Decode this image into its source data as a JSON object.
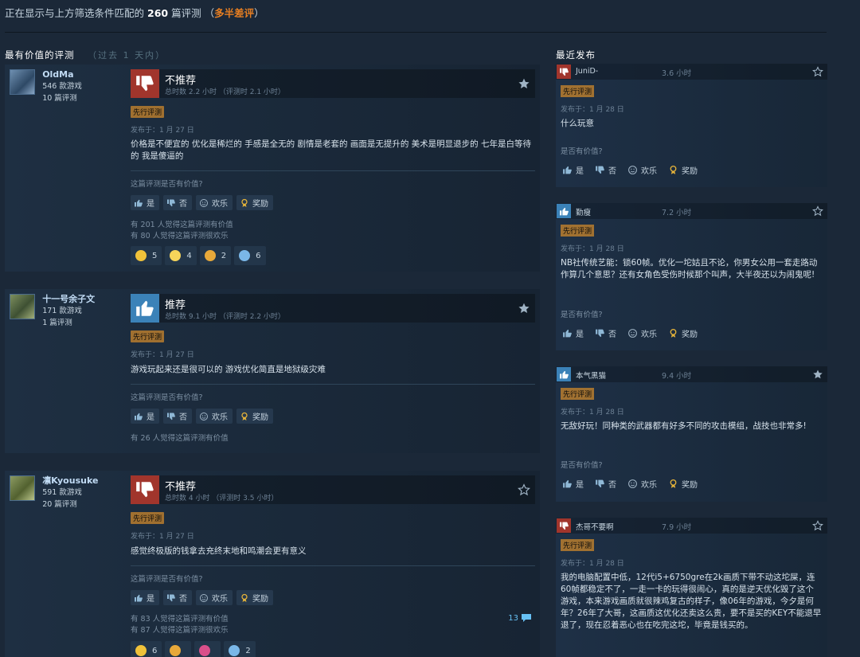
{
  "header": {
    "prefix": "正在显示与上方筛选条件匹配的",
    "count": "260",
    "suffix": "篇评测",
    "paren_open": "（",
    "rating": "多半差评",
    "paren_close": "）"
  },
  "most_helpful": {
    "title": "最有价值的评测",
    "subtitle": "（过去 1 天内）"
  },
  "recent_title": "最近发布",
  "labels": {
    "early_access": "先行评测",
    "helpful_question": "这篇评测是否有价值?",
    "yes": "是",
    "no": "否",
    "funny": "欢乐",
    "award": "奖励",
    "recent_helpful_question": "是否有价值?"
  },
  "reviews": [
    {
      "author": "OldMa",
      "games": "546 款游戏",
      "reviews_count": "10 篇评测",
      "verdict": "不推荐",
      "hours": "总时数 2.2 小时 （评测时 2.1 小时）",
      "posted": "发布于：1 月 27 日",
      "text": "价格是不便宜的 优化是稀烂的 手感是全无的 剧情是老套的 画面是无提升的 美术是明显退步的 七年是白等待的 我是傻逼的",
      "helpful_votes": "有 201 人觉得这篇评测有价值",
      "funny_votes": "有 80 人觉得这篇评测很欢乐",
      "awards": [
        "5",
        "4",
        "2",
        "6"
      ]
    },
    {
      "author": "十一号余子文",
      "games": "171 款游戏",
      "reviews_count": "1 篇评测",
      "verdict": "推荐",
      "hours": "总时数 9.1 小时 （评测时 2.2 小时）",
      "posted": "发布于：1 月 27 日",
      "text": "游戏玩起来还是很可以的 游戏优化简直是地狱级灾难",
      "helpful_votes": "有 26 人觉得这篇评测有价值"
    },
    {
      "author": "凛Kyousuke",
      "games": "591 款游戏",
      "reviews_count": "20 篇评测",
      "verdict": "不推荐",
      "hours": "总时数 4 小时 （评测时 3.5 小时）",
      "posted": "发布于：1 月 27 日",
      "text": "感觉终极版的钱拿去充终末地和鸣潮会更有意义",
      "helpful_votes": "有 83 人觉得这篇评测有价值",
      "funny_votes": "有 87 人觉得这篇评测很欢乐",
      "comments": "13",
      "awards": [
        "6",
        "",
        "",
        "2"
      ]
    }
  ],
  "recent": [
    {
      "author": "JuniD-",
      "hours": "3.6 小时",
      "posted": "发布于：1 月 28 日",
      "text": "什么玩意"
    },
    {
      "author": "勤瘦",
      "hours": "7.2 小时",
      "posted": "发布于：1 月 28 日",
      "text": "NB社传统艺能：锁60帧。优化一坨姑且不论，你男女公用一套走路动作算几个意思？还有女角色受伤时候那个叫声，大半夜还以为闹鬼呢!"
    },
    {
      "author": "本气黑猫",
      "hours": "9.4 小时",
      "posted": "发布于：1 月 28 日",
      "text": "无敌好玩！同种类的武器都有好多不同的攻击模组，战技也非常多!"
    },
    {
      "author": "杰哥不要啊",
      "hours": "7.9 小时",
      "posted": "发布于：1 月 28 日",
      "text": "我的电脑配置中低，12代i5+6750gre在2k画质下带不动这坨屎，连60帧都稳定不了，一走一卡的玩得很闹心，真的是逆天优化毁了这个游戏，本来游戏画质就很辣鸡复古的样子，像06年的游戏，今夕是何年？26年了大哥，这画质这优化还卖这么贵，要不是买的KEY不能退早退了，现在忍着恶心也在吃完这坨，毕竟是钱买的。"
    }
  ]
}
